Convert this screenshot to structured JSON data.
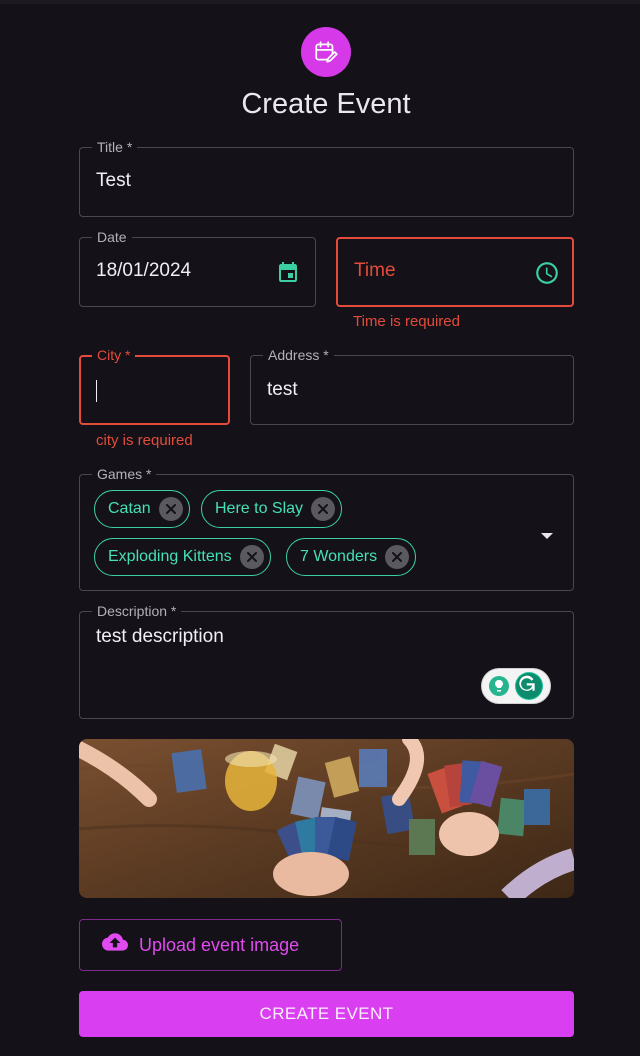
{
  "page": {
    "title": "Create Event"
  },
  "icons": {
    "header": "calendar-edit-icon",
    "date": "calendar-icon",
    "time": "clock-icon",
    "dropdown": "chevron-down-icon",
    "chip_remove": "close-circle-icon",
    "upload": "cloud-upload-icon",
    "grammarly": "grammarly-icon"
  },
  "colors": {
    "accent": "#d93ef0",
    "secondary": "#3ccfa6",
    "error": "#e54b3a",
    "background": "#141218"
  },
  "form": {
    "title": {
      "label": "Title *",
      "value": "Test"
    },
    "date": {
      "label": "Date",
      "value": "18/01/2024"
    },
    "time": {
      "placeholder": "Time",
      "error": "Time is required"
    },
    "city": {
      "label": "City *",
      "value": "",
      "error": "city is required"
    },
    "address": {
      "label": "Address *",
      "value": "test"
    },
    "games": {
      "label": "Games *",
      "selected": [
        "Catan",
        "Here to Slay",
        "Exploding Kittens",
        "7 Wonders"
      ]
    },
    "description": {
      "label": "Description *",
      "value": "test description"
    }
  },
  "actions": {
    "upload_label": "Upload event image",
    "submit_label": "CREATE EVENT"
  }
}
